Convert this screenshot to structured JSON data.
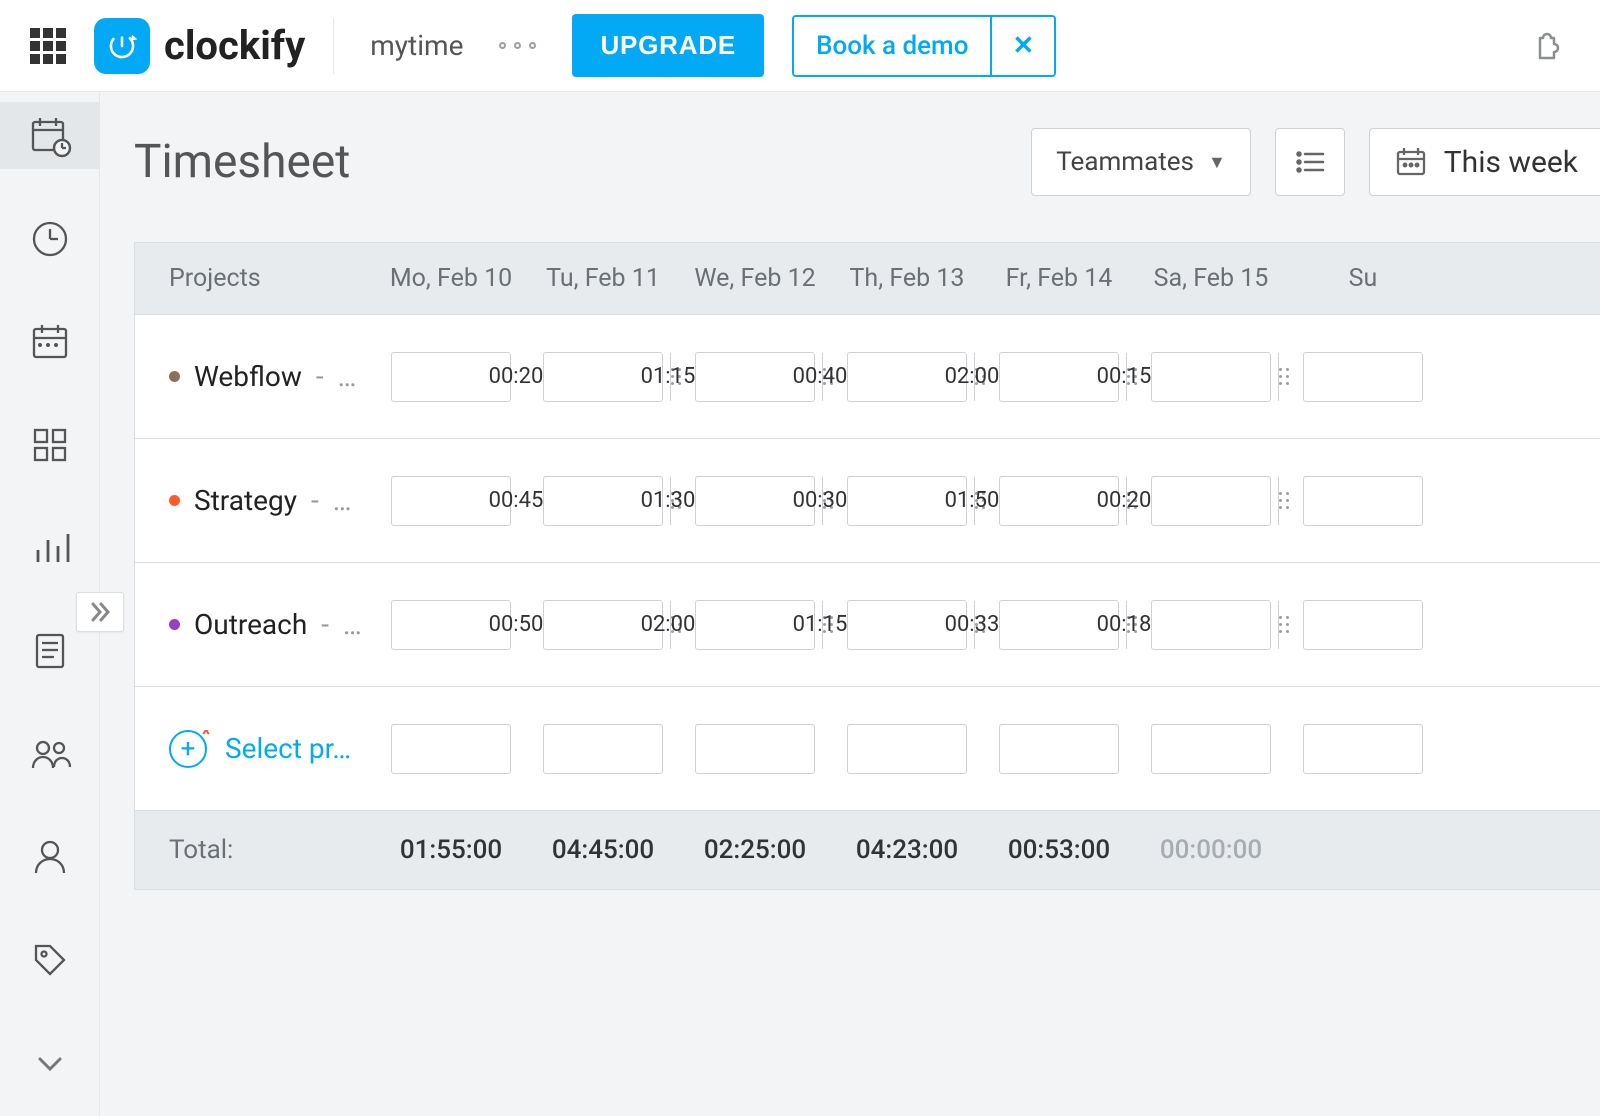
{
  "brand": {
    "name": "clockify"
  },
  "header": {
    "workspace": "mytime",
    "upgrade_label": "UPGRADE",
    "demo_label": "Book a demo",
    "demo_close": "✕"
  },
  "sidebar": {
    "items": [
      {
        "name": "timesheet",
        "active": true
      },
      {
        "name": "time-tracker"
      },
      {
        "name": "calendar"
      },
      {
        "name": "dashboard"
      },
      {
        "name": "reports"
      },
      {
        "name": "projects"
      },
      {
        "name": "team"
      },
      {
        "name": "clients"
      },
      {
        "name": "tags"
      }
    ],
    "more_name": "more"
  },
  "page": {
    "title": "Timesheet",
    "teammates_label": "Teammates",
    "range_label": "This week"
  },
  "sheet": {
    "project_header": "Projects",
    "days": [
      {
        "label": "Mo, Feb 10"
      },
      {
        "label": "Tu, Feb 11"
      },
      {
        "label": "We, Feb 12"
      },
      {
        "label": "Th, Feb 13"
      },
      {
        "label": "Fr, Feb 14"
      },
      {
        "label": "Sa, Feb 15"
      },
      {
        "label": "Su"
      }
    ],
    "rows": [
      {
        "color": "#8b6f5c",
        "name": "Webflow",
        "extra": "…",
        "times": [
          "00:20:00",
          "01:15:00",
          "00:40:00",
          "02:00:00",
          "00:15:00",
          "",
          ""
        ]
      },
      {
        "color": "#ff5c2e",
        "name": "Strategy",
        "extra": "…",
        "times": [
          "00:45:00",
          "01:30:00",
          "00:30:00",
          "01:50:00",
          "00:20:00",
          "",
          ""
        ]
      },
      {
        "color": "#9b3fbf",
        "name": "Outreach",
        "extra": "…",
        "times": [
          "00:50:00",
          "02:00:00",
          "01:15:00",
          "00:33:00",
          "00:18:00",
          "",
          ""
        ]
      }
    ],
    "select_project_label": "Select pr…",
    "totals": {
      "label": "Total:",
      "values": [
        "01:55:00",
        "04:45:00",
        "02:25:00",
        "04:23:00",
        "00:53:00",
        "00:00:00",
        ""
      ]
    }
  }
}
